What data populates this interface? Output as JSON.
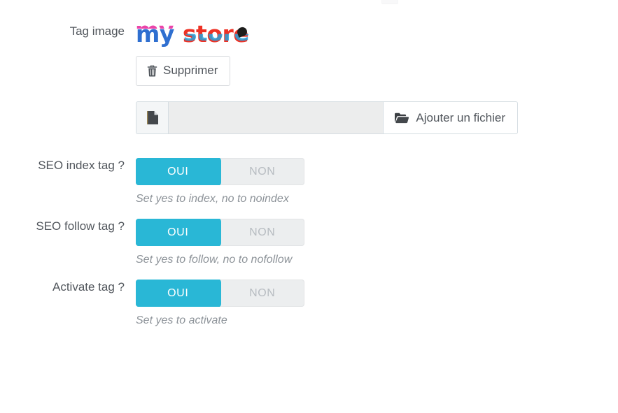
{
  "logo": {
    "word1": "my",
    "word2": "store",
    "alt": "my store",
    "colors": {
      "blue": "#2f6fd0",
      "magenta": "#e8249b",
      "red": "#ee3124",
      "cyan": "#29a3dc",
      "black": "#1d1d1b"
    }
  },
  "accent_color": "#29b7d6",
  "rows": {
    "tag_image": {
      "label": "Tag image",
      "delete_button": "Supprimer",
      "delete_icon": "trash-icon"
    },
    "file_input": {
      "file_icon": "file-icon",
      "filename_value": "",
      "filename_placeholder": "",
      "add_button": "Ajouter un fichier",
      "add_icon": "open-folder-icon"
    },
    "seo_index": {
      "label": "SEO index tag ?",
      "option_yes": "OUI",
      "option_no": "NON",
      "selected": "OUI",
      "help": "Set yes to index, no to noindex"
    },
    "seo_follow": {
      "label": "SEO follow tag ?",
      "option_yes": "OUI",
      "option_no": "NON",
      "selected": "OUI",
      "help": "Set yes to follow, no to nofollow"
    },
    "activate": {
      "label": "Activate tag ?",
      "option_yes": "OUI",
      "option_no": "NON",
      "selected": "OUI",
      "help": "Set yes to activate"
    }
  }
}
